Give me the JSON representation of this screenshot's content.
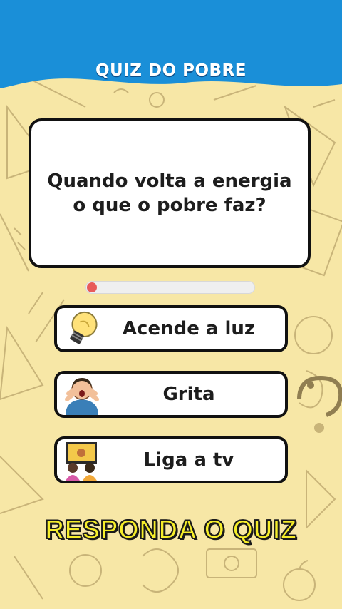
{
  "header": {
    "title": "QUIZ DO POBRE"
  },
  "question": {
    "line1": "Quando volta a energia",
    "line2": "o que o pobre faz?"
  },
  "timer": {
    "progress": 0.03
  },
  "options": [
    {
      "label": "Acende a luz",
      "icon": "light-bulb-icon"
    },
    {
      "label": "Grita",
      "icon": "screaming-person-icon"
    },
    {
      "label": "Liga a tv",
      "icon": "people-watching-tv-icon"
    }
  ],
  "cta": {
    "text": "RESPONDA O QUIZ"
  },
  "colors": {
    "header_blue": "#1a8fd8",
    "background": "#f7e7a6",
    "timer_fill": "#e85a5a",
    "cta_yellow": "#f6ee2a"
  }
}
